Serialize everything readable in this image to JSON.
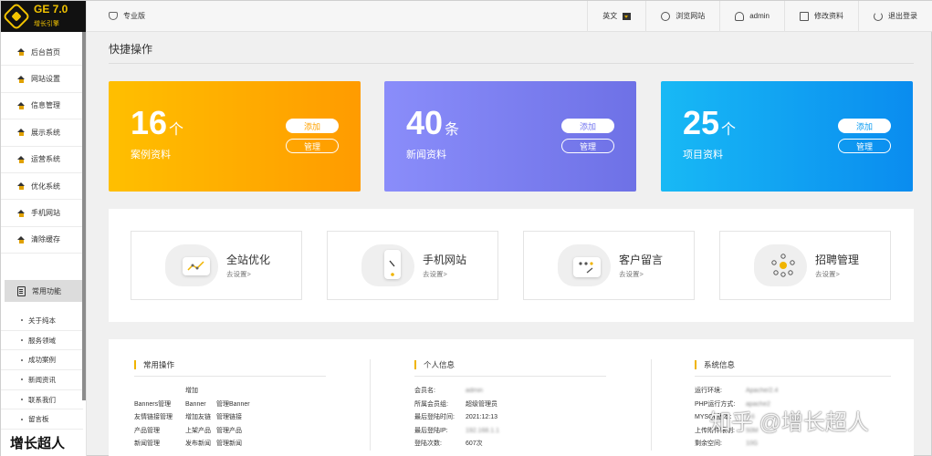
{
  "logo": {
    "title": "GE 7.0",
    "subtitle": "增长引擎"
  },
  "topbar": {
    "version": "专业版",
    "lang": "英文",
    "browse": "浏览网站",
    "user": "admin",
    "edit": "修改资料",
    "logout": "退出登录"
  },
  "sidebar": {
    "items": [
      "后台首页",
      "网站设置",
      "信息管理",
      "展示系统",
      "运营系统",
      "优化系统",
      "手机网站",
      "清除缓存"
    ],
    "common_label": "常用功能",
    "sub_items": [
      "关于纯本",
      "服务领域",
      "成功案例",
      "新闻资讯",
      "联系我们",
      "留言板"
    ],
    "brand": "增长超人"
  },
  "quick": {
    "title": "快捷操作",
    "cards": [
      {
        "num": "16",
        "unit": "个",
        "name": "案例资料",
        "add": "添加",
        "manage": "管理"
      },
      {
        "num": "40",
        "unit": "条",
        "name": "新闻资料",
        "add": "添加",
        "manage": "管理"
      },
      {
        "num": "25",
        "unit": "个",
        "name": "项目资料",
        "add": "添加",
        "manage": "管理"
      }
    ]
  },
  "shortcuts": [
    {
      "title": "全站优化",
      "sub": "去设置>",
      "icon": "chart-icon"
    },
    {
      "title": "手机网站",
      "sub": "去设置>",
      "icon": "phone-icon"
    },
    {
      "title": "客户留言",
      "sub": "去设置>",
      "icon": "message-icon"
    },
    {
      "title": "招聘管理",
      "sub": "去设置>",
      "icon": "people-icon"
    }
  ],
  "info": {
    "ops": {
      "title": "常用操作",
      "rows": [
        [
          "Banners管理",
          "增加Banner",
          "管理Banner"
        ],
        [
          "友情链接管理",
          "增加友链",
          "管理链接"
        ],
        [
          "产品管理",
          "上架产品",
          "管理产品"
        ],
        [
          "新闻管理",
          "发布新闻",
          "管理新闻"
        ]
      ]
    },
    "personal": {
      "title": "个人信息",
      "rows": [
        {
          "k": "会员名:",
          "v": "admin"
        },
        {
          "k": "所属会员组:",
          "v": "超级管理员"
        },
        {
          "k": "最后登陆时间:",
          "v": "2021:12:13"
        },
        {
          "k": "最后登陆IP:",
          "v": "192.168.1.1"
        },
        {
          "k": "登陆次数:",
          "v": "607次"
        }
      ]
    },
    "system": {
      "title": "系统信息",
      "rows": [
        {
          "k": "运行环境:",
          "v": "Apache/2.4"
        },
        {
          "k": "PHP运行方式:",
          "v": "apache2"
        },
        {
          "k": "MYSQL版本:",
          "v": "5.6"
        },
        {
          "k": "上传附件限制:",
          "v": "50M"
        },
        {
          "k": "剩余空间:",
          "v": "10G"
        }
      ]
    }
  },
  "watermark": "知乎 @增长超人"
}
